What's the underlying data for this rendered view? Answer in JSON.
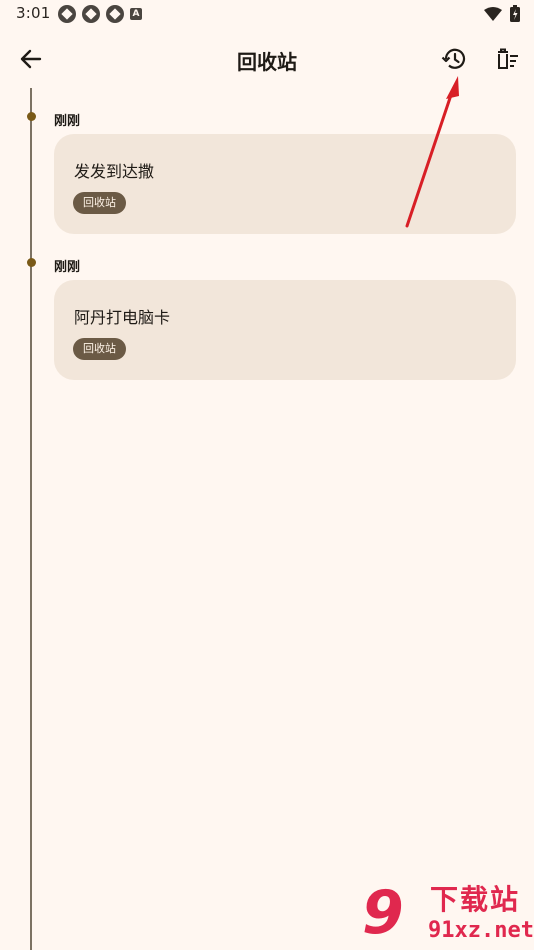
{
  "status_bar": {
    "time": "3:01",
    "a_icon_text": "A"
  },
  "app_bar": {
    "title": "回收站",
    "back_icon": "arrow-back-icon",
    "history_icon": "history-restore-icon",
    "clear_icon": "delete-sweep-icon"
  },
  "groups": [
    {
      "label": "刚刚",
      "note": {
        "title": "发发到达撒",
        "tag": "回收站"
      }
    },
    {
      "label": "刚刚",
      "note": {
        "title": "阿丹打电脑卡",
        "tag": "回收站"
      }
    }
  ],
  "watermark": {
    "logo_text": "9",
    "brand": "下载站",
    "domain": "91xz.net"
  },
  "colors": {
    "background": "#fff7f1",
    "card": "#f2e6da",
    "tag": "#6b5a45",
    "timeline_dot": "#7a5a18",
    "annotation_arrow": "#d81f26",
    "watermark": "#e0284e"
  }
}
